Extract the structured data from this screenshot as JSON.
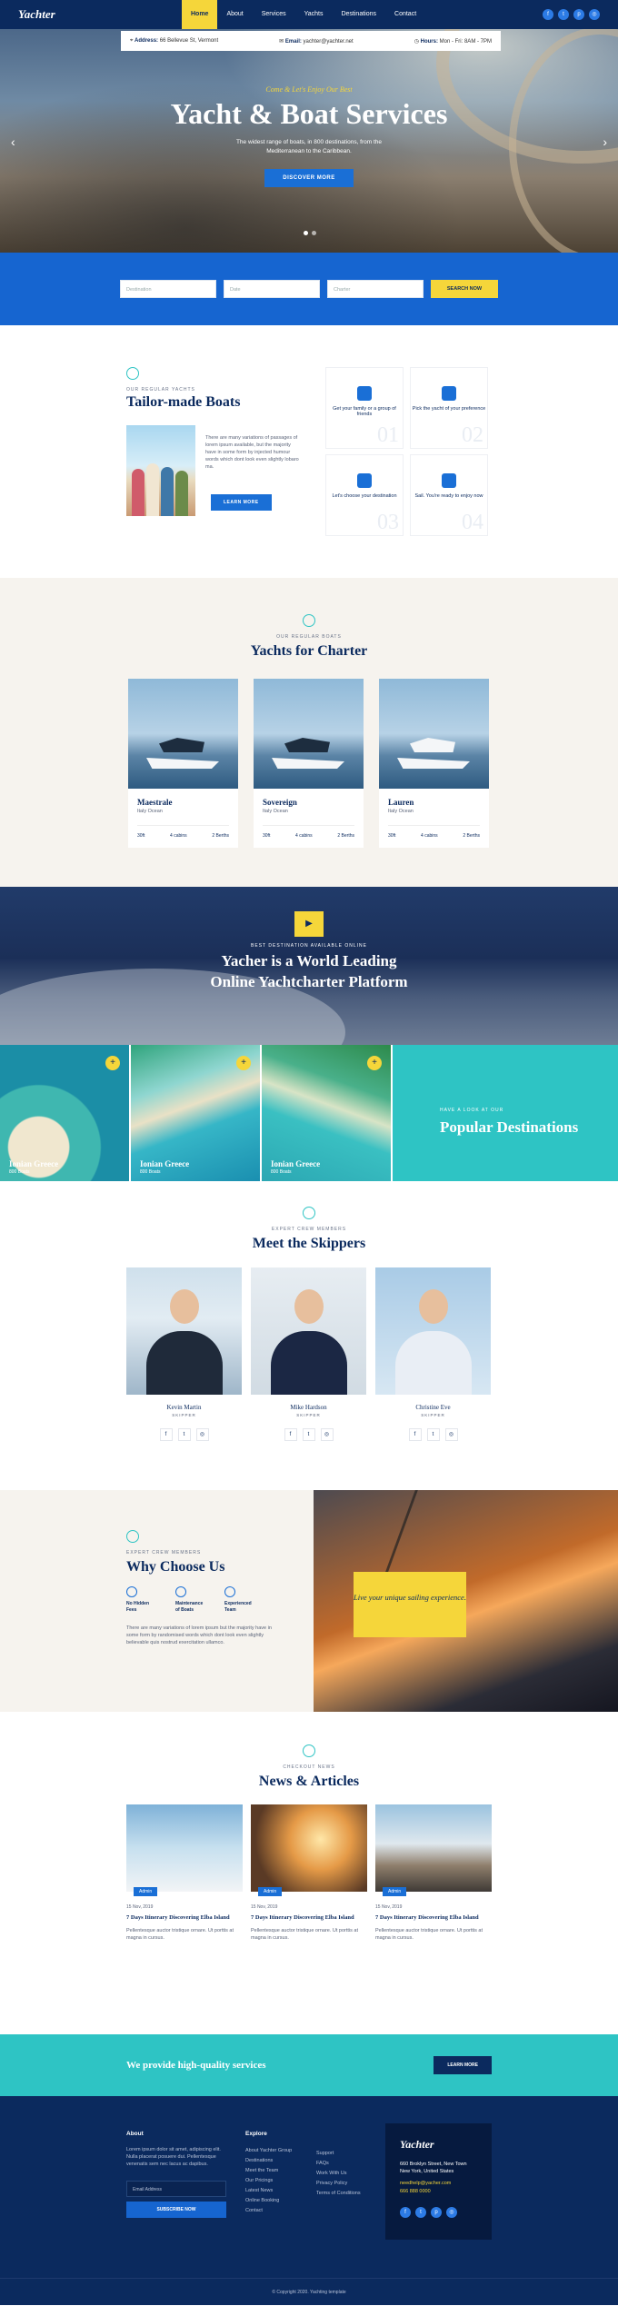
{
  "nav": {
    "logo": "Yachter",
    "items": [
      "Home",
      "About",
      "Services",
      "Yachts",
      "Destinations",
      "Contact"
    ],
    "active_index": 0
  },
  "infobar": {
    "address_label": "Address:",
    "address": "66 Bellevue St, Vermont",
    "email_label": "Email:",
    "email": "yachter@yachter.net",
    "hours_label": "Hours:",
    "hours": "Mon - Fri: 8AM - 7PM"
  },
  "hero": {
    "kicker": "Come & Let's Enjoy Our Best",
    "title": "Yacht & Boat Services",
    "text": "The widest range of boats, in 800 destinations, from the Mediterranean to the Caribbean.",
    "button": "DISCOVER MORE"
  },
  "search": {
    "field1": "Destination",
    "field2": "Date",
    "field3": "Charter",
    "button": "SEARCH NOW"
  },
  "tailor": {
    "kicker": "OUR REGULAR YACHTS",
    "title": "Tailor-made Boats",
    "text": "There are many variations of passages of lorem ipsum available, but the majority have in some form by injected humour words which dont look even slightly lobaro ma.",
    "button": "LEARN MORE",
    "features": [
      {
        "label": "Get your family or a group of friends",
        "num": "01"
      },
      {
        "label": "Pick the yacht of your preference",
        "num": "02"
      },
      {
        "label": "Let's choose your destination",
        "num": "03"
      },
      {
        "label": "Sail. You're ready to enjoy now",
        "num": "04"
      }
    ]
  },
  "charter": {
    "kicker": "OUR REGULAR BOATS",
    "title": "Yachts for Charter",
    "cards": [
      {
        "name": "Maestrale",
        "loc": "Italy Ocean",
        "size": "30ft",
        "cabins": "4 cabins",
        "berths": "2 Berths"
      },
      {
        "name": "Sovereign",
        "loc": "Italy Ocean",
        "size": "30ft",
        "cabins": "4 cabins",
        "berths": "2 Berths"
      },
      {
        "name": "Lauren",
        "loc": "Italy Ocean",
        "size": "30ft",
        "cabins": "4 cabins",
        "berths": "2 Berths"
      }
    ]
  },
  "platform": {
    "kicker": "BEST DESTINATION AVAILABLE ONLINE",
    "line1": "Yacher is a World Leading",
    "line2": "Online Yachtcharter Platform"
  },
  "destinations": {
    "tiles": [
      {
        "name": "Ionian Greece",
        "count": "800 Boats"
      },
      {
        "name": "Ionian Greece",
        "count": "800 Boats"
      },
      {
        "name": "Ionian Greece",
        "count": "800 Boats"
      }
    ],
    "kicker": "HAVE A LOOK AT OUR",
    "title": "Popular Destinations"
  },
  "skippers": {
    "kicker": "EXPERT CREW MEMBERS",
    "title": "Meet the Skippers",
    "people": [
      {
        "name": "Kevin Martin",
        "role": "SKIPPER"
      },
      {
        "name": "Mike Hardson",
        "role": "SKIPPER"
      },
      {
        "name": "Christine Eve",
        "role": "SKIPPER"
      }
    ]
  },
  "why": {
    "kicker": "EXPERT CREW MEMBERS",
    "title": "Why Choose Us",
    "items": [
      "No Hidden Fees",
      "Maintenance of Boats",
      "Experienced Team"
    ],
    "text": "There are many variations of lorem ipsum but the majority have in some form by randomised words which dont look even slightly believable quis nostrud exercitation ullamco.",
    "banner": "Live your unique sailing experience."
  },
  "news": {
    "kicker": "CHECKOUT NEWS",
    "title": "News & Articles",
    "posts": [
      {
        "tag": "Admin",
        "date": "15 Nov, 2019",
        "title": "7 Days Itinerary Discovering Elba Island",
        "excerpt": "Pellentesque auctor tristique ornare. Ut porttis at magna in cursus."
      },
      {
        "tag": "Admin",
        "date": "15 Nov, 2019",
        "title": "7 Days Itinerary Discovering Elba Island",
        "excerpt": "Pellentesque auctor tristique ornare. Ut porttis at magna in cursus."
      },
      {
        "tag": "Admin",
        "date": "15 Nov, 2019",
        "title": "7 Days Itinerary Discovering Elba Island",
        "excerpt": "Pellentesque auctor tristique ornare. Ut porttis at magna in cursus."
      }
    ]
  },
  "cta": {
    "text": "We provide high-quality services",
    "button": "LEARN MORE"
  },
  "footer": {
    "about_title": "About",
    "about_text": "Lorem ipsum dolor sit amet, adipiscing elit. Nulla placerat posuere dui. Pellentesque venenatis sem nec lacus ac dapibus.",
    "email_placeholder": "Email Address",
    "subscribe": "SUBSCRIBE NOW",
    "explore_title": "Explore",
    "col1": [
      "About Yachter Group",
      "Destinations",
      "Meet the Team",
      "Our Pricings",
      "Latest News",
      "Online Booking",
      "Contact"
    ],
    "col2": [
      "Support",
      "FAQs",
      "Work With Us",
      "Privacy Policy",
      "Terms of Conditions"
    ],
    "logo": "Yachter",
    "address": "660 Broklyn Street, New Town New York, United States",
    "email": "needhelp@yacher.com",
    "phone": "666 888 0000",
    "copyright": "© Copyright 2020. Yachting template"
  },
  "colors": {
    "navy": "#0b2a5e",
    "blue": "#1665d0",
    "yellow": "#f5d63a",
    "teal": "#2ec4c4",
    "cream": "#f6f3ee"
  }
}
